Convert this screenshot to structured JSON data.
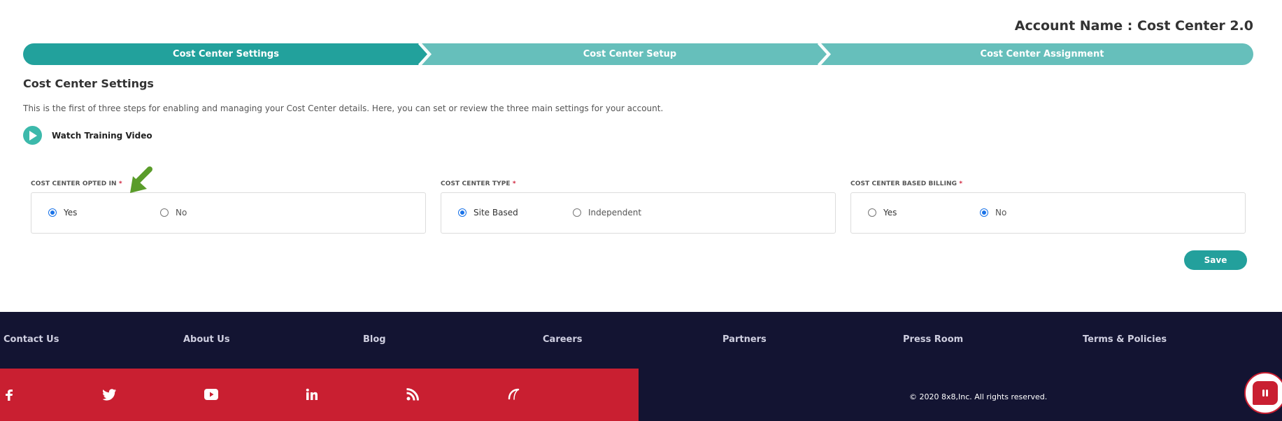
{
  "header": {
    "account_name": "Account Name : Cost Center 2.0"
  },
  "stepper": {
    "steps": [
      {
        "label": "Cost Center Settings",
        "active": true
      },
      {
        "label": "Cost Center Setup",
        "active": false
      },
      {
        "label": "Cost Center Assignment",
        "active": false
      }
    ],
    "colors": {
      "active": "#22a19c",
      "inactive": "#66bfbb"
    }
  },
  "main": {
    "title": "Cost Center Settings",
    "description": "This is the first of three steps for enabling and managing your Cost Center details. Here, you can set or review the three main settings for your account.",
    "video_link": "Watch Training Video",
    "fields": [
      {
        "label": "COST CENTER OPTED IN",
        "required_mark": "*",
        "options": [
          {
            "label": "Yes",
            "checked": true
          },
          {
            "label": "No",
            "checked": false
          }
        ]
      },
      {
        "label": "COST CENTER TYPE",
        "required_mark": "*",
        "options": [
          {
            "label": "Site Based",
            "checked": true
          },
          {
            "label": "Independent",
            "checked": false
          }
        ]
      },
      {
        "label": "COST CENTER BASED BILLING",
        "required_mark": "*",
        "options": [
          {
            "label": "Yes",
            "checked": false
          },
          {
            "label": "No",
            "checked": true
          }
        ]
      }
    ],
    "save_label": "Save"
  },
  "footer": {
    "nav": [
      "Contact Us",
      "About Us",
      "Blog",
      "Careers",
      "Partners",
      "Press Room",
      "Terms & Policies"
    ],
    "social_icons": [
      "facebook-icon",
      "twitter-icon",
      "youtube-icon",
      "linkedin-icon",
      "rss-icon",
      "8x8-logo-icon"
    ],
    "copyright": "© 2020 8x8,Inc. All rights reserved.",
    "colors": {
      "nav_bg": "#131432",
      "social_bg": "#c91f31"
    }
  }
}
